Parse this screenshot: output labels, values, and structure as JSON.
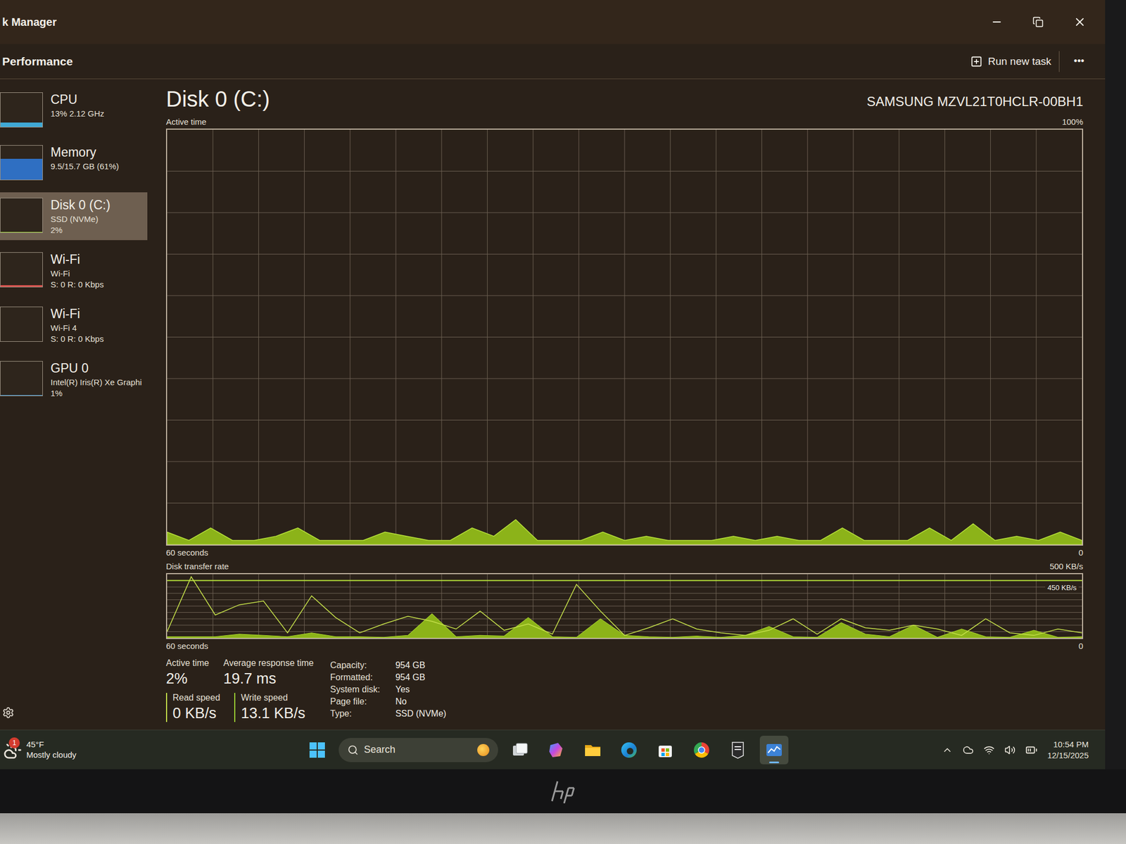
{
  "window": {
    "title": "k Manager"
  },
  "header": {
    "title": "Performance",
    "run_task": "Run new task",
    "more": "•••"
  },
  "sidebar": {
    "items": [
      {
        "name": "CPU",
        "lines": [
          "13% 2.12 GHz"
        ],
        "level": 0.13,
        "color": "#3fa9d6",
        "selected": false
      },
      {
        "name": "Memory",
        "lines": [
          "9.5/15.7 GB (61%)"
        ],
        "level": 0.61,
        "color": "#2f6fc2",
        "selected": false
      },
      {
        "name": "Disk 0 (C:)",
        "lines": [
          "SSD (NVMe)",
          "2%"
        ],
        "level": 0.02,
        "color": "#9acd32",
        "selected": true
      },
      {
        "name": "Wi-Fi",
        "lines": [
          "Wi-Fi",
          "S: 0 R: 0 Kbps"
        ],
        "level": 0.05,
        "color": "#d9534f",
        "selected": false
      },
      {
        "name": "Wi-Fi",
        "lines": [
          "Wi-Fi 4",
          "S: 0 R: 0 Kbps"
        ],
        "level": 0,
        "color": "#d9534f",
        "selected": false
      },
      {
        "name": "GPU 0",
        "lines": [
          "Intel(R) Iris(R) Xe Graphi",
          "1%"
        ],
        "level": 0.01,
        "color": "#4aa3df",
        "selected": false
      }
    ]
  },
  "disk": {
    "title": "Disk 0 (C:)",
    "model": "SAMSUNG MZVL21T0HCLR-00BH1",
    "active_chart": {
      "label": "Active time",
      "max": "100%",
      "max_value": 100,
      "time": "60 seconds",
      "min": "0",
      "values": [
        3,
        1,
        4,
        1,
        1,
        2,
        4,
        1,
        1,
        1,
        3,
        2,
        1,
        1,
        4,
        2,
        6,
        1,
        1,
        1,
        3,
        1,
        2,
        1,
        1,
        1,
        2,
        1,
        2,
        1,
        1,
        4,
        1,
        1,
        1,
        4,
        1,
        5,
        1,
        2,
        1,
        3,
        1
      ]
    },
    "transfer_chart": {
      "label": "Disk transfer rate",
      "max": "500 KB/s",
      "max_value": 500,
      "marker": "450 KB/s",
      "marker_value": 450,
      "time": "60 seconds",
      "min": "0",
      "series": [
        {
          "kind": "area",
          "values": [
            10,
            10,
            10,
            30,
            20,
            10,
            40,
            10,
            10,
            5,
            20,
            190,
            10,
            20,
            15,
            160,
            10,
            5,
            150,
            20,
            10,
            5,
            15,
            5,
            20,
            90,
            10,
            5,
            120,
            30,
            10,
            100,
            5,
            70,
            10,
            5,
            60,
            5,
            10
          ]
        },
        {
          "kind": "line",
          "values": [
            50,
            480,
            180,
            260,
            290,
            40,
            330,
            160,
            40,
            110,
            170,
            130,
            70,
            210,
            60,
            110,
            30,
            420,
            210,
            20,
            80,
            150,
            70,
            40,
            20,
            60,
            150,
            30,
            150,
            80,
            60,
            100,
            70,
            20,
            150,
            40,
            20,
            70,
            40
          ]
        }
      ]
    },
    "stats": [
      {
        "label": "Active time",
        "value": "2%"
      },
      {
        "label": "Average response time",
        "value": "19.7 ms"
      }
    ],
    "speeds": [
      {
        "label": "Read speed",
        "value": "0 KB/s"
      },
      {
        "label": "Write speed",
        "value": "13.1 KB/s"
      }
    ],
    "properties": [
      {
        "label": "Capacity:",
        "value": "954 GB"
      },
      {
        "label": "Formatted:",
        "value": "954 GB"
      },
      {
        "label": "System disk:",
        "value": "Yes"
      },
      {
        "label": "Page file:",
        "value": "No"
      },
      {
        "label": "Type:",
        "value": "SSD (NVMe)"
      }
    ]
  },
  "taskbar": {
    "weather": {
      "temp": "45°F",
      "text": "Mostly cloudy",
      "badge": "1"
    },
    "search": {
      "placeholder": "Search"
    },
    "apps": [
      {
        "kind": "task-view",
        "selected": false
      },
      {
        "kind": "copilot",
        "selected": false
      },
      {
        "kind": "explorer",
        "selected": false
      },
      {
        "kind": "edge",
        "selected": false
      },
      {
        "kind": "store",
        "selected": false
      },
      {
        "kind": "chrome",
        "selected": false
      },
      {
        "kind": "epic",
        "selected": false
      },
      {
        "kind": "task-manager",
        "selected": true
      }
    ],
    "time": "10:54 PM",
    "date": "12/15/2025"
  }
}
